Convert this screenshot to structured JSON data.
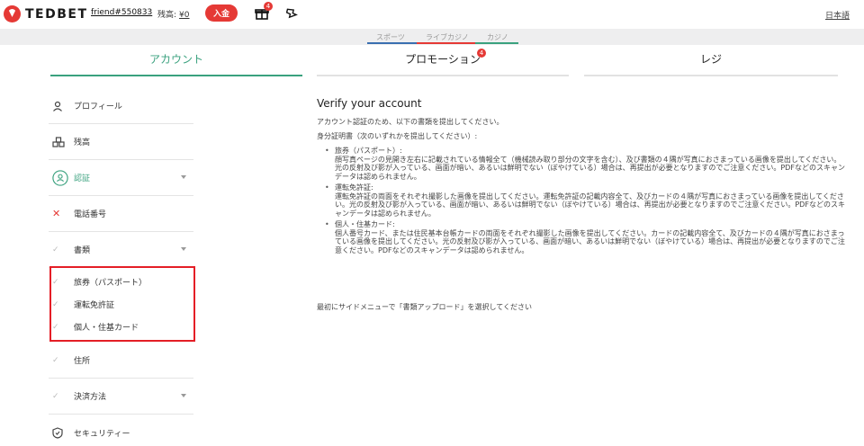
{
  "header": {
    "logo_text": "TEDBET",
    "user": "friend#550833",
    "balance_label": "残高:",
    "balance_value": "¥0",
    "deposit_label": "入金",
    "gift_badge": "4",
    "language": "日本語"
  },
  "strip_tabs": [
    {
      "label": "スポーツ",
      "color": "#3a6fb0"
    },
    {
      "label": "ライブカジノ",
      "color": "#e53935"
    },
    {
      "label": "カジノ",
      "color": "#3aa17e"
    }
  ],
  "main_tabs": [
    {
      "label": "アカウント",
      "active": true
    },
    {
      "label": "プロモーション",
      "badge": "4"
    },
    {
      "label": "レジ"
    }
  ],
  "sidebar": {
    "profile": "プロフィール",
    "balance": "残高",
    "verification": "認証",
    "phone": "電話番号",
    "documents": "書類",
    "sub_items": [
      "旅券（パスポート）",
      "運転免許証",
      "個人・住基カード"
    ],
    "address": "住所",
    "payment": "決済方法",
    "security": "セキュリティー"
  },
  "content": {
    "title": "Verify your account",
    "intro": "アカウント認証のため、以下の書類を提出してください。",
    "id_heading": "身分証明書（次のいずれかを提出してください）:",
    "bullets": [
      {
        "title": "旅券（パスポート）:",
        "body": "顔写真ページの見開き左右に記載されている情報全て（機械読み取り部分の文字を含む）、及び書類の４隅が写真におさまっている画像を提出してください。光の反射及び影が入っている、画面が暗い、あるいは鮮明でない（ぼやけている）場合は、再提出が必要となりますのでご注意ください。PDFなどのスキャンデータは認められません。"
      },
      {
        "title": "運転免許証:",
        "body": "運転免許証の両面をそれぞれ撮影した画像を提出してください。運転免許証の記載内容全て、及びカードの４隅が写真におさまっている画像を提出してください。光の反射及び影が入っている、画面が暗い、あるいは鮮明でない（ぼやけている）場合は、再提出が必要となりますのでご注意ください。PDFなどのスキャンデータは認められません。"
      },
      {
        "title": "個人・住基カード:",
        "body": "個人番号カード、または住民基本台帳カードの両面をそれぞれ撮影した画像を提出してください。カードの記載内容全て、及びカードの４隅が写真におさまっている画像を提出してください。光の反射及び影が入っている、画面が暗い、あるいは鮮明でない（ぼやけている）場合は、再提出が必要となりますのでご注意ください。PDFなどのスキャンデータは認められません。"
      }
    ],
    "footer": "最初にサイドメニューで「書類アップロード」を選択してください"
  },
  "colors": {
    "brand_red": "#e53935",
    "accent_green": "#3aa17e",
    "highlight_box": "#e41e26"
  }
}
